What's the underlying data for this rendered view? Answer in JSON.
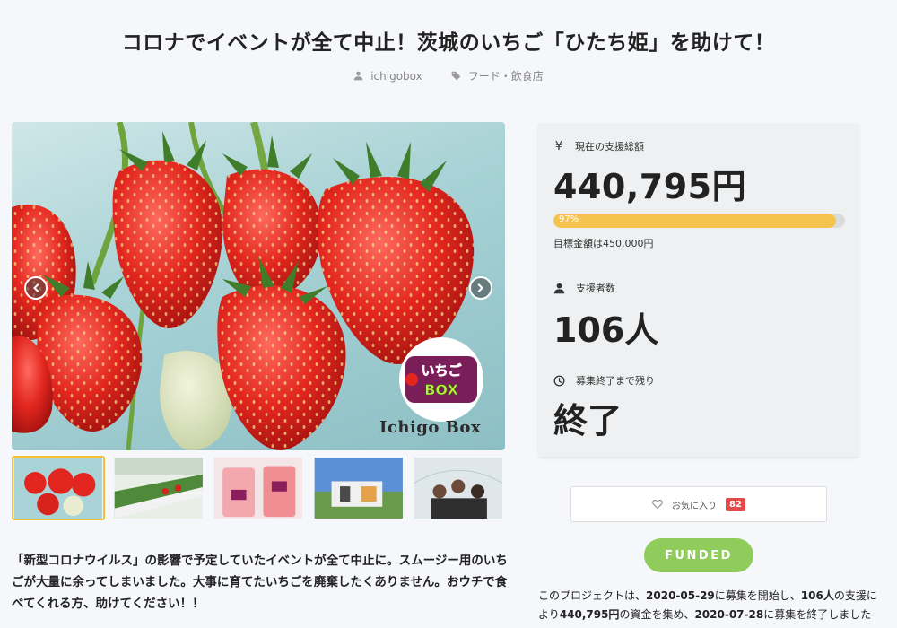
{
  "page": {
    "title": "コロナでイベントが全て中止！茨城のいちご「ひたち姫」を助けて！",
    "author": "ichigobox",
    "category": "フード・飲食店"
  },
  "hero": {
    "logo_text_top": "いちご",
    "logo_text_bottom": "BOX",
    "caption": "Ichigo Box"
  },
  "thumbnails": [
    {
      "label": "strawberries-closeup",
      "active": true
    },
    {
      "label": "strawberry-greenhouse-rows",
      "active": false
    },
    {
      "label": "strawberry-smoothies",
      "active": false
    },
    {
      "label": "event-booth",
      "active": false
    },
    {
      "label": "group-photo-greenhouse",
      "active": false
    }
  ],
  "description": "「新型コロナウイルス」の影響で予定していたイベントが全て中止に。スムージー用のいちごが大量に余ってしまいました。大事に育てたいちごを廃棄したくありません。おウチで食べてくれる方、助けてください！！",
  "stats": {
    "total_label": "現在の支援総額",
    "total_amount": "440,795円",
    "progress_percent": 97,
    "progress_label": "97%",
    "goal_text": "目標金額は450,000円",
    "supporters_label": "支援者数",
    "supporters_value": "106人",
    "remaining_label": "募集終了まで残り",
    "remaining_value": "終了"
  },
  "favorite": {
    "label": "お気に入り",
    "count": "82"
  },
  "status_button": "FUNDED",
  "summary": {
    "p1": "このプロジェクトは、",
    "start_date": "2020-05-29",
    "p2": "に募集を開始し、",
    "supporters": "106人",
    "p3": "の支援により",
    "amount": "440,795円",
    "p4": "の資金を集め、",
    "end_date": "2020-07-28",
    "p5": "に募集を終了しました"
  },
  "colors": {
    "accent_yellow": "#f5c44e",
    "funded_green": "#8fcc5c",
    "badge_red": "#e24b4b"
  }
}
